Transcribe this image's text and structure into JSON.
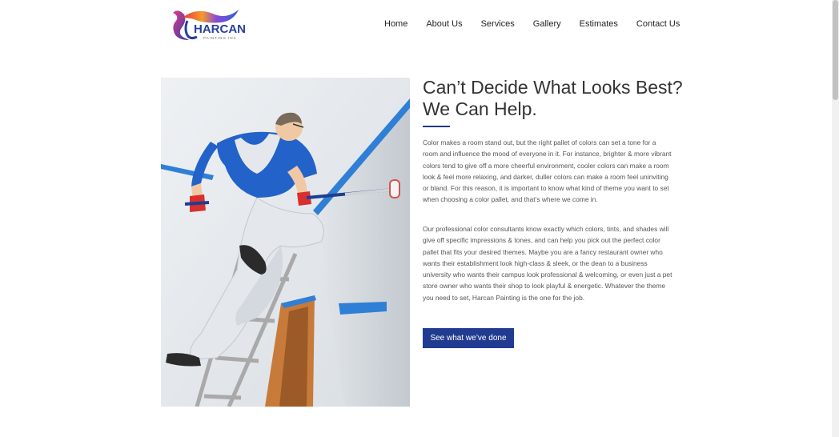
{
  "header": {
    "logo_text": "HARCAN",
    "logo_subtext": "PAINTING INC"
  },
  "nav": {
    "items": [
      {
        "label": "Home"
      },
      {
        "label": "About Us"
      },
      {
        "label": "Services"
      },
      {
        "label": "Gallery"
      },
      {
        "label": "Estimates"
      },
      {
        "label": "Contact Us"
      }
    ]
  },
  "hero": {
    "headline_line1": "Can’t Decide What Looks Best?",
    "headline_line2": "We Can Help.",
    "paragraph1": "Color makes a room stand out, but the right pallet of colors can set a tone for a room and influence the mood of everyone in it. For instance, brighter & more vibrant colors tend to give off a more cheerful environment, cooler colors can make a room look & feel more relaxing, and darker, duller colors can make a room feel uninviting or bland. For this reason, it is important to know what kind of theme you want to set when choosing a color pallet, and that’s where we come in.",
    "paragraph2": "Our professional color consultants know exactly which colors, tints, and shades will give off specific impressions & tones, and can help you pick out the perfect color pallet that fits your desired themes. Maybe you are a fancy restaurant owner who wants their establishment look high-class & sleek, or the dean to a business university who wants their campus look professional & welcoming, or even just a pet store owner who wants their shop to look playful & energetic. Whatever the theme you need to set, Harcan Painting is the one for the job.",
    "cta_label": "See what we’ve done"
  },
  "colors": {
    "accent": "#213b90",
    "divider": "#1f3a93"
  }
}
